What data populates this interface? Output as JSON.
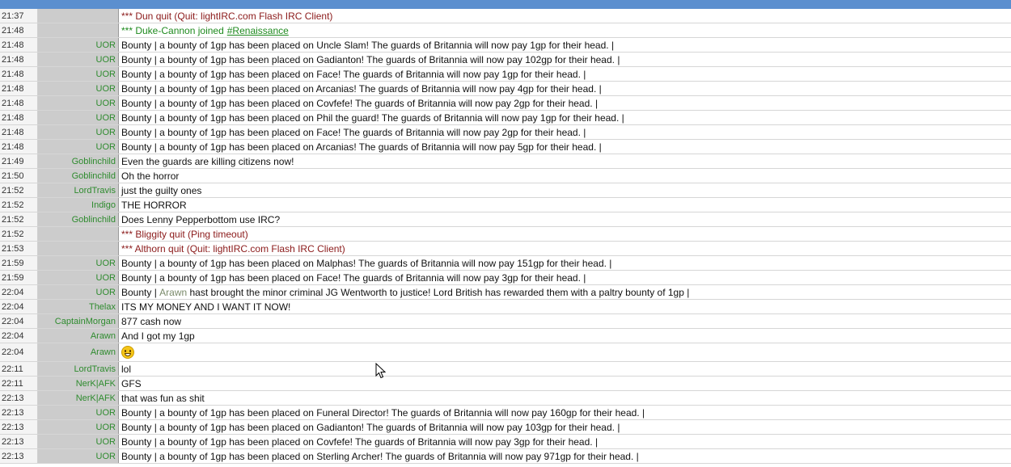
{
  "colors": {
    "nick": "#2e8b2e",
    "quit": "#8b1a1a",
    "join": "#1e8a1e",
    "highlight": "#7a8a6a",
    "topbar": "#5b8fcf"
  },
  "rows": [
    {
      "time": "21:37",
      "nick": "",
      "type": "quit",
      "text": "*** Dun quit (Quit: lightIRC.com Flash IRC Client)"
    },
    {
      "time": "21:48",
      "nick": "",
      "type": "join",
      "text": "*** Duke-Cannon joined",
      "channel": "#Renaissance"
    },
    {
      "time": "21:48",
      "nick": "UOR",
      "type": "msg",
      "text": "Bounty | a bounty of 1gp has been placed on Uncle Slam! The guards of Britannia will now pay 1gp for their head. |"
    },
    {
      "time": "21:48",
      "nick": "UOR",
      "type": "msg",
      "text": "Bounty | a bounty of 1gp has been placed on Gadianton! The guards of Britannia will now pay 102gp for their head. |"
    },
    {
      "time": "21:48",
      "nick": "UOR",
      "type": "msg",
      "text": "Bounty | a bounty of 1gp has been placed on Face! The guards of Britannia will now pay 1gp for their head. |"
    },
    {
      "time": "21:48",
      "nick": "UOR",
      "type": "msg",
      "text": "Bounty | a bounty of 1gp has been placed on Arcanias! The guards of Britannia will now pay 4gp for their head. |"
    },
    {
      "time": "21:48",
      "nick": "UOR",
      "type": "msg",
      "text": "Bounty | a bounty of 1gp has been placed on Covfefe! The guards of Britannia will now pay 2gp for their head. |"
    },
    {
      "time": "21:48",
      "nick": "UOR",
      "type": "msg",
      "text": "Bounty | a bounty of 1gp has been placed on Phil the guard! The guards of Britannia will now pay 1gp for their head. |"
    },
    {
      "time": "21:48",
      "nick": "UOR",
      "type": "msg",
      "text": "Bounty | a bounty of 1gp has been placed on Face! The guards of Britannia will now pay 2gp for their head. |"
    },
    {
      "time": "21:48",
      "nick": "UOR",
      "type": "msg",
      "text": "Bounty | a bounty of 1gp has been placed on Arcanias! The guards of Britannia will now pay 5gp for their head. |"
    },
    {
      "time": "21:49",
      "nick": "Goblinchild",
      "type": "msg",
      "text": "Even the guards are killing citizens now!"
    },
    {
      "time": "21:50",
      "nick": "Goblinchild",
      "type": "msg",
      "text": "Oh the horror"
    },
    {
      "time": "21:52",
      "nick": "LordTravis",
      "type": "msg",
      "text": "just the guilty ones"
    },
    {
      "time": "21:52",
      "nick": "Indigo",
      "type": "msg",
      "text": "THE HORROR"
    },
    {
      "time": "21:52",
      "nick": "Goblinchild",
      "type": "msg",
      "text": "Does Lenny Pepperbottom use IRC?"
    },
    {
      "time": "21:52",
      "nick": "",
      "type": "quit",
      "text": "*** Bliggity quit (Ping timeout)"
    },
    {
      "time": "21:53",
      "nick": "",
      "type": "quit",
      "text": "*** Althorn quit (Quit: lightIRC.com Flash IRC Client)"
    },
    {
      "time": "21:59",
      "nick": "UOR",
      "type": "msg",
      "text": "Bounty | a bounty of 1gp has been placed on Malphas! The guards of Britannia will now pay 151gp for their head. |"
    },
    {
      "time": "21:59",
      "nick": "UOR",
      "type": "msg",
      "text": "Bounty | a bounty of 1gp has been placed on Face! The guards of Britannia will now pay 3gp for their head. |"
    },
    {
      "time": "22:04",
      "nick": "UOR",
      "type": "msg",
      "pre": "Bounty | ",
      "hl": "Arawn",
      "text": " hast brought the minor criminal JG Wentworth to justice! Lord British has rewarded them with a paltry bounty of 1gp |"
    },
    {
      "time": "22:04",
      "nick": "Thelax",
      "type": "msg",
      "text": "ITS MY MONEY AND I WANT IT NOW!"
    },
    {
      "time": "22:04",
      "nick": "CaptainMorgan",
      "type": "msg",
      "text": "877 cash now"
    },
    {
      "time": "22:04",
      "nick": "Arawn",
      "type": "msg",
      "text": "And I got my 1gp"
    },
    {
      "time": "22:04",
      "nick": "Arawn",
      "type": "emoji",
      "text": "",
      "icon": "grin-emoji-icon"
    },
    {
      "time": "22:11",
      "nick": "LordTravis",
      "type": "msg",
      "text": "lol"
    },
    {
      "time": "22:11",
      "nick": "NerK|AFK",
      "type": "msg",
      "text": "GFS"
    },
    {
      "time": "22:13",
      "nick": "NerK|AFK",
      "type": "msg",
      "text": "that was fun as shit"
    },
    {
      "time": "22:13",
      "nick": "UOR",
      "type": "msg",
      "text": "Bounty | a bounty of 1gp has been placed on Funeral Director! The guards of Britannia will now pay 160gp for their head. |"
    },
    {
      "time": "22:13",
      "nick": "UOR",
      "type": "msg",
      "text": "Bounty | a bounty of 1gp has been placed on Gadianton! The guards of Britannia will now pay 103gp for their head. |"
    },
    {
      "time": "22:13",
      "nick": "UOR",
      "type": "msg",
      "text": "Bounty | a bounty of 1gp has been placed on Covfefe! The guards of Britannia will now pay 3gp for their head. |"
    },
    {
      "time": "22:13",
      "nick": "UOR",
      "type": "msg",
      "text": "Bounty | a bounty of 1gp has been placed on Sterling Archer! The guards of Britannia will now pay 971gp for their head. |"
    }
  ]
}
